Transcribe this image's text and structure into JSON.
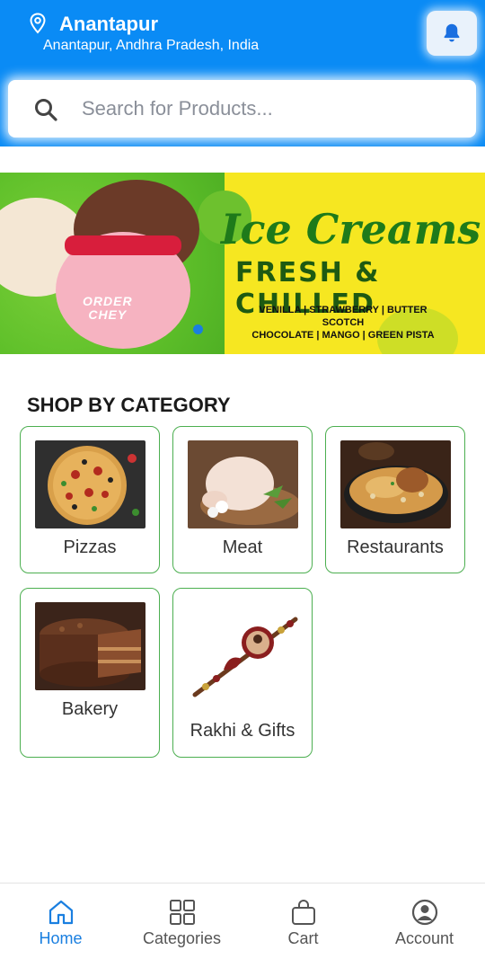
{
  "header": {
    "city": "Anantapur",
    "address": "Anantapur, Andhra Pradesh, India",
    "notification_icon": "bell-icon",
    "location_icon": "map-pin-icon"
  },
  "search": {
    "placeholder": "Search for Products...",
    "value": ""
  },
  "banner": {
    "title": "Ice Creams",
    "subtitle": "FRESH & CHILLED",
    "flavors_line1": "VENILLA | STRAWBERRY | BUTTER SCOTCH",
    "flavors_line2": "CHOCOLATE | MANGO | GREEN PISTA",
    "scoop_text_line1": "ORDER",
    "scoop_text_line2": "CHEY",
    "active_slide": 1,
    "slide_count": 2
  },
  "categories": {
    "title": "SHOP BY CATEGORY",
    "items": [
      {
        "label": "Pizzas"
      },
      {
        "label": "Meat"
      },
      {
        "label": "Restaurants"
      },
      {
        "label": "Bakery"
      },
      {
        "label": "Rakhi & Gifts"
      }
    ]
  },
  "bottom_nav": {
    "items": [
      {
        "label": "Home",
        "icon": "home-icon",
        "active": true
      },
      {
        "label": "Categories",
        "icon": "grid-icon",
        "active": false
      },
      {
        "label": "Cart",
        "icon": "shopping-bag-icon",
        "active": false
      },
      {
        "label": "Account",
        "icon": "user-circle-icon",
        "active": false
      }
    ]
  },
  "colors": {
    "header_bg": "#0a8bf5",
    "accent": "#1a7fe0",
    "card_border": "#4caf50"
  }
}
